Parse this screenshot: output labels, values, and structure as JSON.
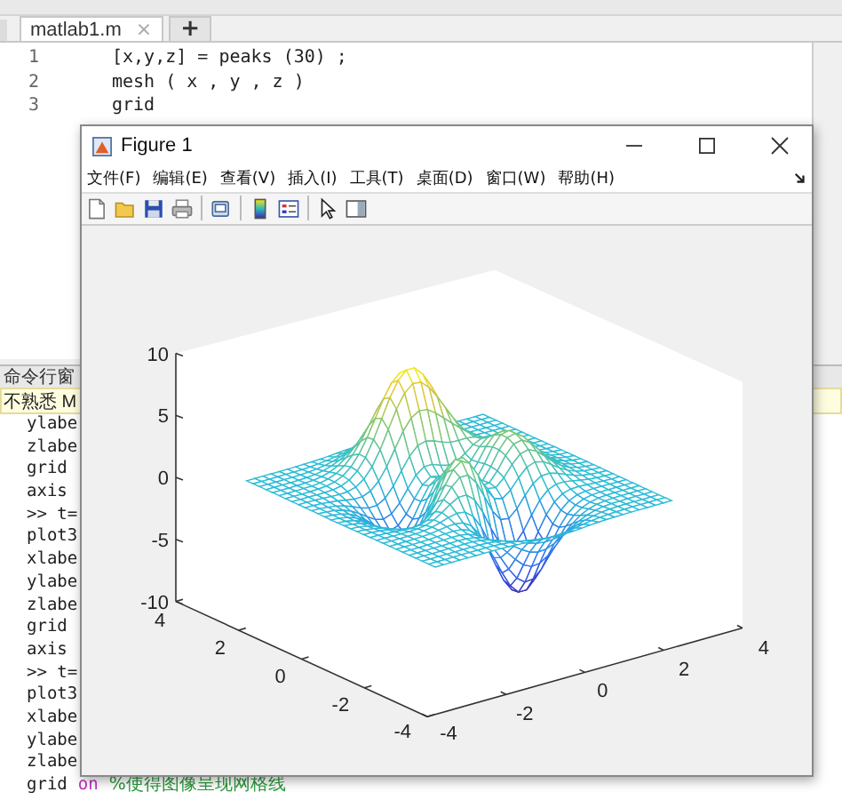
{
  "editor": {
    "tabs": [
      {
        "label": "matlab1.m",
        "close": "×",
        "selected": true
      }
    ],
    "new_tab": "+",
    "lines": [
      {
        "number": "1",
        "code": "[x,y,z] = peaks (30) ;"
      },
      {
        "number": "2",
        "code": "mesh ( x , y , z )"
      },
      {
        "number": "3",
        "code": "grid"
      }
    ]
  },
  "command_window": {
    "title": "命令行窗",
    "notice": "不熟悉 M",
    "lines": [
      [
        {
          "text": "ylabe",
          "kind": "code"
        }
      ],
      [
        {
          "text": "zlabe",
          "kind": "code"
        }
      ],
      [
        {
          "text": "grid",
          "kind": "code"
        }
      ],
      [
        {
          "text": "axis",
          "kind": "code"
        }
      ],
      [
        {
          "text": ">> t=",
          "kind": "code"
        }
      ],
      [
        {
          "text": "plot3",
          "kind": "code"
        }
      ],
      [
        {
          "text": "xlabe",
          "kind": "code"
        }
      ],
      [
        {
          "text": "ylabe",
          "kind": "code"
        }
      ],
      [
        {
          "text": "zlabe",
          "kind": "code"
        }
      ],
      [
        {
          "text": "grid",
          "kind": "code"
        }
      ],
      [
        {
          "text": "axis",
          "kind": "code"
        }
      ],
      [
        {
          "text": ">> t=",
          "kind": "code"
        }
      ],
      [
        {
          "text": "plot3",
          "kind": "code"
        }
      ],
      [
        {
          "text": "xlabe",
          "kind": "code"
        }
      ],
      [
        {
          "text": "ylabe",
          "kind": "code"
        }
      ],
      [
        {
          "text": "zlabe",
          "kind": "code"
        }
      ],
      [
        {
          "text": "grid",
          "kind": "code"
        },
        {
          "text": "on",
          "kind": "keyword"
        },
        {
          "text": "%使得图像呈现网格线",
          "kind": "comment"
        }
      ]
    ]
  },
  "figure": {
    "title": "Figure 1",
    "menu": [
      "文件(F)",
      "编辑(E)",
      "查看(V)",
      "插入(I)",
      "工具(T)",
      "桌面(D)",
      "窗口(W)",
      "帮助(H)"
    ],
    "axes": {
      "z_ticks": [
        "10",
        "5",
        "0",
        "-5",
        "-10"
      ],
      "y_ticks": [
        "4",
        "2",
        "0",
        "-2",
        "-4"
      ],
      "x_ticks": [
        "-4",
        "-2",
        "0",
        "2",
        "4"
      ]
    }
  }
}
